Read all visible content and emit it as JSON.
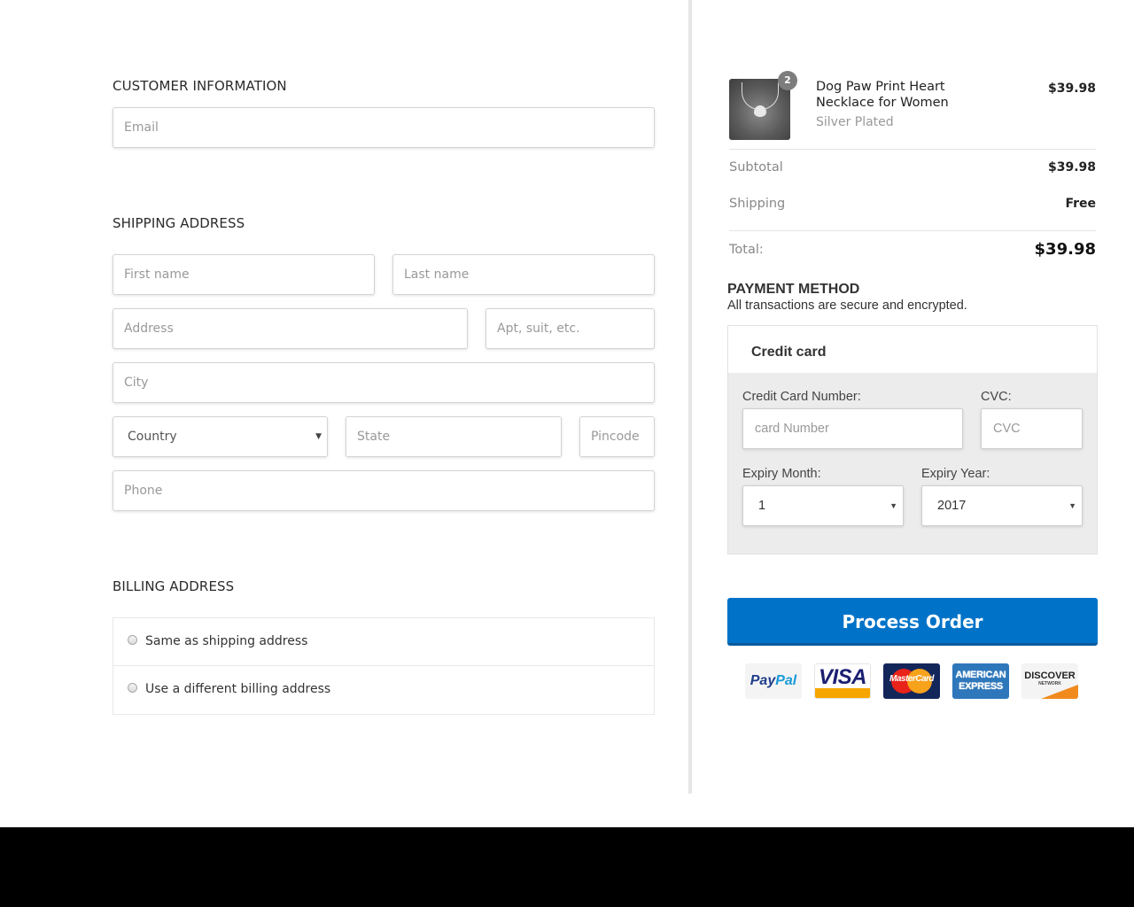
{
  "customer": {
    "title": "CUSTOMER INFORMATION",
    "email_placeholder": "Email"
  },
  "shipping": {
    "title": "SHIPPING ADDRESS",
    "first_name_placeholder": "First name",
    "last_name_placeholder": "Last name",
    "address_placeholder": "Address",
    "apt_placeholder": "Apt, suit, etc.",
    "city_placeholder": "City",
    "country_selected": "Country",
    "state_placeholder": "State",
    "pincode_placeholder": "Pincode",
    "phone_placeholder": "Phone"
  },
  "billing": {
    "title": "BILLING ADDRESS",
    "option_same": "Same as shipping address",
    "option_different": "Use a different billing address"
  },
  "order": {
    "item": {
      "quantity": "2",
      "name": "Dog Paw Print Heart Necklace for Women",
      "variant": "Silver Plated",
      "price": "$39.98"
    },
    "subtotal_label": "Subtotal",
    "subtotal_value": "$39.98",
    "shipping_label": "Shipping",
    "shipping_value": "Free",
    "total_label": "Total:",
    "total_value": "$39.98"
  },
  "payment": {
    "title": "PAYMENT METHOD",
    "subtitle": "All transactions are secure and encrypted.",
    "method_label": "Credit card",
    "card_number_label": "Credit Card Number:",
    "card_number_placeholder": "card Number",
    "cvc_label": "CVC:",
    "cvc_placeholder": "CVC",
    "expiry_month_label": "Expiry Month:",
    "expiry_month_value": "1",
    "expiry_year_label": "Expiry Year:",
    "expiry_year_value": "2017",
    "submit_label": "Process Order"
  },
  "card_logos": {
    "paypal_a": "Pay",
    "paypal_b": "Pal",
    "visa": "VISA",
    "mastercard": "MasterCard",
    "amex_a": "AMERICAN",
    "amex_b": "EXPRESS",
    "discover": "DISCOVER",
    "discover_sub": "NETWORK"
  },
  "colors": {
    "primary_button": "#0073c8",
    "payment_panel": "#ececec",
    "divider": "#e6e6e6"
  }
}
